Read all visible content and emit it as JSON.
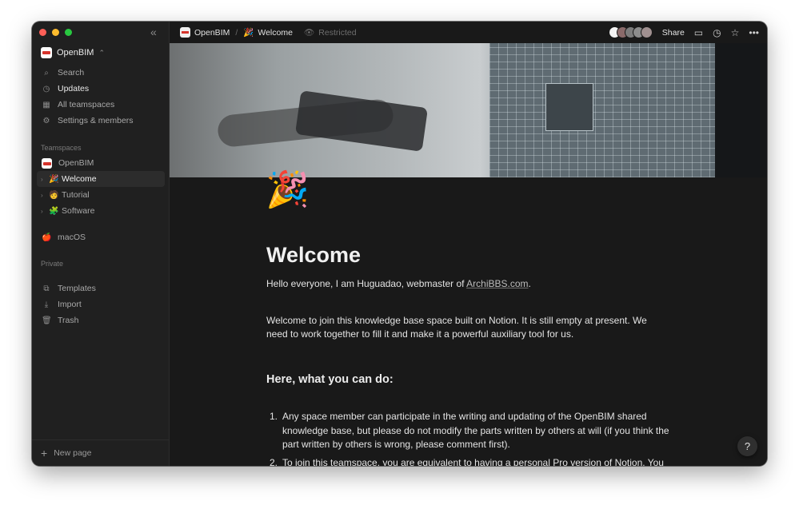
{
  "sidebar": {
    "workspace_name": "OpenBIM",
    "nav": [
      {
        "label": "Search",
        "icon": "search-icon"
      },
      {
        "label": "Updates",
        "icon": "clock-icon"
      },
      {
        "label": "All teamspaces",
        "icon": "grid-icon"
      },
      {
        "label": "Settings & members",
        "icon": "gear-icon"
      }
    ],
    "teamspaces_label": "Teamspaces",
    "teamspace": "OpenBIM",
    "pages": [
      {
        "label": "Welcome",
        "emoji": "🎉"
      },
      {
        "label": "Tutorial",
        "emoji": "🧑"
      },
      {
        "label": "Software",
        "emoji": "🧩"
      }
    ],
    "macos": {
      "label": "macOS",
      "emoji": "🍎"
    },
    "private_label": "Private",
    "tools": [
      {
        "label": "Templates",
        "icon": "templates-icon"
      },
      {
        "label": "Import",
        "icon": "import-icon"
      },
      {
        "label": "Trash",
        "icon": "trash-icon"
      }
    ],
    "new_page": "New page"
  },
  "topbar": {
    "crumb_workspace": "OpenBIM",
    "crumb_page_emoji": "🎉",
    "crumb_page": "Welcome",
    "restricted": "Restricted",
    "share": "Share"
  },
  "page": {
    "emoji": "🎉",
    "title": "Welcome",
    "intro_prefix": "Hello everyone, I am Huguadao, webmaster of ",
    "intro_link": "ArchiBBS.com",
    "intro_suffix": ".",
    "welcome_text": "Welcome to join this knowledge base space built on Notion. It is still empty at present. We need to work together to fill it and make it a powerful auxiliary tool for us.",
    "heading": "Here, what you can do:",
    "list": [
      {
        "num": "1.",
        "text": "Any space member can participate in the writing and updating of the OpenBIM shared knowledge base, but please do not modify the parts written by others at will (if you think the part written by others is wrong, please comment first)."
      },
      {
        "num": "2.",
        "text": "To join this teamspace, you are equivalent to having a personal Pro version of Notion. You can also compile draft posts in a private space, export Markdown for posting posts on the"
      }
    ]
  },
  "help": "?",
  "colors": {
    "background": "#191919",
    "sidebar": "#202020",
    "accent_red": "#d6342c"
  }
}
